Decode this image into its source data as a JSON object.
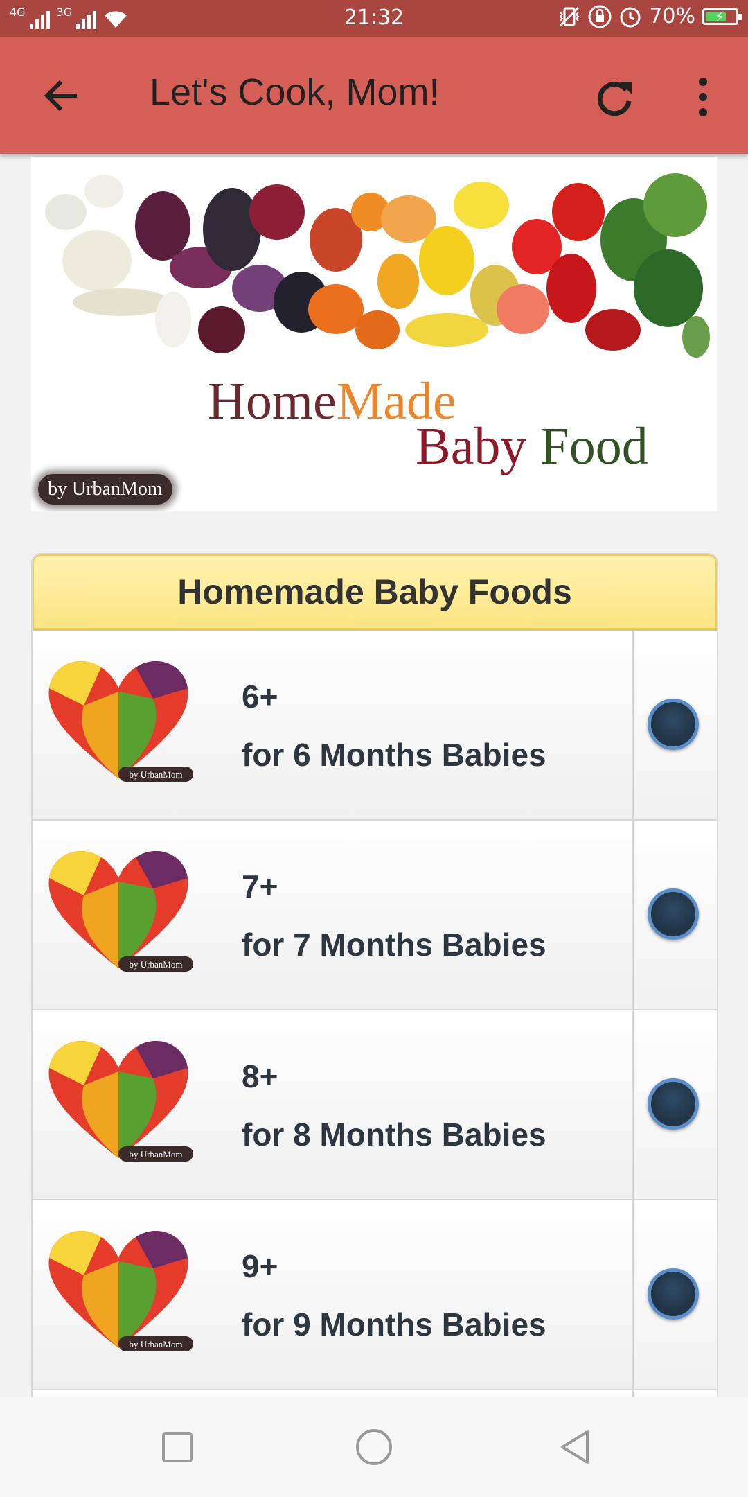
{
  "status_bar": {
    "time": "21:32",
    "network_1": "4G",
    "network_2": "3G",
    "battery": "70%",
    "battery_level": 0.7,
    "icons": [
      "signal-icon",
      "signal-icon",
      "wifi-icon",
      "vibrate-icon",
      "lock-icon",
      "alarm-icon",
      "battery-charging-icon"
    ]
  },
  "app_bar": {
    "title": "Let's Cook, Mom!",
    "icons": [
      "back-arrow-icon",
      "refresh-icon",
      "more-vert-icon"
    ]
  },
  "banner": {
    "line1_home": "Home",
    "line1_made": "Made",
    "line2_baby": "Baby",
    "line2_food": "Food",
    "byline": "by UrbanMom"
  },
  "list": {
    "header": "Homemade Baby Foods",
    "items": [
      {
        "age": "6+",
        "label": "for 6 Months Babies",
        "thumb_caption": "by UrbanMom"
      },
      {
        "age": "7+",
        "label": "for 7 Months Babies",
        "thumb_caption": "by UrbanMom"
      },
      {
        "age": "8+",
        "label": "for 8 Months Babies",
        "thumb_caption": "by UrbanMom"
      },
      {
        "age": "9+",
        "label": "for 9 Months Babies",
        "thumb_caption": "by UrbanMom"
      }
    ]
  },
  "colors": {
    "status_bar": "#a9463f",
    "app_bar": "#d55f57",
    "header_yellow": "#fbe582",
    "radio_blue": "#2f4a66"
  },
  "nav_bar": {
    "icons": [
      "recents-square-icon",
      "home-circle-icon",
      "back-triangle-icon"
    ]
  }
}
